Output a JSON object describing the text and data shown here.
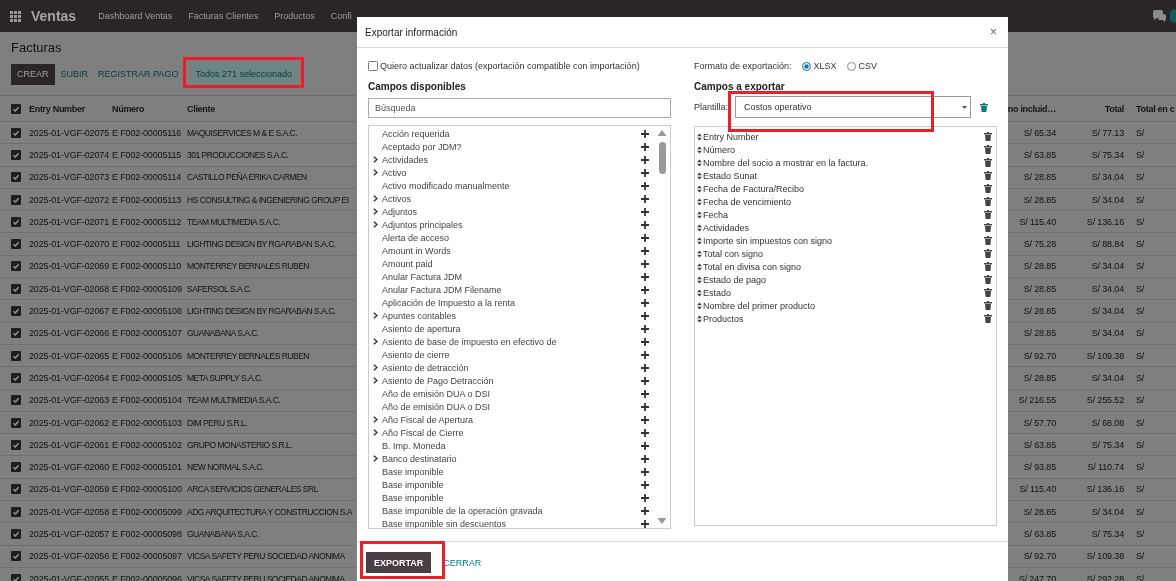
{
  "navbar": {
    "app": "Ventas",
    "menu": [
      "Dashboard Ventas",
      "Facturas Clientes",
      "Productos",
      "Confi"
    ]
  },
  "page": {
    "title": "Facturas",
    "buttons": [
      "CREAR",
      "SUBIR",
      "REGISTRAR PAGO"
    ],
    "selection_badge": "Todos 271 seleccionado"
  },
  "table": {
    "all_selected": true,
    "columns": [
      "Entry Number",
      "Número",
      "Cliente",
      "no incluid…",
      "Total",
      "Total en c"
    ],
    "rows": [
      {
        "selected": true,
        "cells": [
          "2025-01-VGF-02075",
          "E F002-00005116",
          "MAQUISERVICES M & E S.A.C.",
          "S/ 65.34",
          "S/ 77.13",
          "S/"
        ]
      },
      {
        "selected": true,
        "cells": [
          "2025-01-VGF-02074",
          "E F002-00005115",
          "301 PRODUCCIONES S.A.C.",
          "S/ 63.85",
          "S/ 75.34",
          "S/"
        ]
      },
      {
        "selected": true,
        "cells": [
          "2025-01-VGF-02073",
          "E F002-00005114",
          "CASTILLO PEÑA ERIKA CARMEN",
          "S/ 28.85",
          "S/ 34.04",
          "S/"
        ]
      },
      {
        "selected": true,
        "cells": [
          "2025-01-VGF-02072",
          "E F002-00005113",
          "HS CONSULTING & INGENIERING GROUP EI",
          "S/ 28.85",
          "S/ 34.04",
          "S/"
        ]
      },
      {
        "selected": true,
        "cells": [
          "2025-01-VGF-02071",
          "E F002-00005112",
          "TEAM MULTIMEDIA S.A.C.",
          "S/ 115.40",
          "S/ 136.16",
          "S/"
        ]
      },
      {
        "selected": true,
        "cells": [
          "2025-01-VGF-02070",
          "E F002-00005111",
          "LIGHTING DESIGN BY RGARABAN S.A.C.",
          "S/ 75.28",
          "S/ 88.84",
          "S/"
        ]
      },
      {
        "selected": true,
        "cells": [
          "2025-01-VGF-02069",
          "E F002-00005110",
          "MONTERREY BERNALES RUBEN",
          "S/ 28.85",
          "S/ 34.04",
          "S/"
        ]
      },
      {
        "selected": true,
        "cells": [
          "2025-01-VGF-02068",
          "E F002-00005109",
          "SAFERSOL S.A.C.",
          "S/ 28.85",
          "S/ 34.04",
          "S/"
        ]
      },
      {
        "selected": true,
        "cells": [
          "2025-01-VGF-02067",
          "E F002-00005108",
          "LIGHTING DESIGN BY RGARABAN S.A.C.",
          "S/ 28.85",
          "S/ 34.04",
          "S/"
        ]
      },
      {
        "selected": true,
        "cells": [
          "2025-01-VGF-02066",
          "E F002-00005107",
          "GUANABANA S.A.C.",
          "S/ 28.85",
          "S/ 34.04",
          "S/"
        ]
      },
      {
        "selected": true,
        "cells": [
          "2025-01-VGF-02065",
          "E F002-00005106",
          "MONTERREY BERNALES RUBEN",
          "S/ 92.70",
          "S/ 109.38",
          "S/"
        ]
      },
      {
        "selected": true,
        "cells": [
          "2025-01-VGF-02064",
          "E F002-00005105",
          "META SUPPLY S.A.C.",
          "S/ 28.85",
          "S/ 34.04",
          "S/"
        ]
      },
      {
        "selected": true,
        "cells": [
          "2025-01-VGF-02063",
          "E F002-00005104",
          "TEAM MULTIMEDIA S.A.C.",
          "S/ 216.55",
          "S/ 255.52",
          "S/"
        ]
      },
      {
        "selected": true,
        "cells": [
          "2025-01-VGF-02062",
          "E F002-00005103",
          "DIM PERU S.R.L.",
          "S/ 57.70",
          "S/ 68.08",
          "S/"
        ]
      },
      {
        "selected": true,
        "cells": [
          "2025-01-VGF-02061",
          "E F002-00005102",
          "GRUPO MONASTERIO S.R.L.",
          "S/ 63.85",
          "S/ 75.34",
          "S/"
        ]
      },
      {
        "selected": true,
        "cells": [
          "2025-01-VGF-02060",
          "E F002-00005101",
          "NEW NORMAL S.A.C.",
          "S/ 93.85",
          "S/ 110.74",
          "S/"
        ]
      },
      {
        "selected": true,
        "cells": [
          "2025-01-VGF-02059",
          "E F002-00005100",
          "ARCA SERVICIOS GENERALES SRL",
          "S/ 115.40",
          "S/ 136.16",
          "S/"
        ]
      },
      {
        "selected": true,
        "cells": [
          "2025-01-VGF-02058",
          "E F002-00005099",
          "ADG ARQUITECTURA Y CONSTRUCCION S.A",
          "S/ 28.85",
          "S/ 34.04",
          "S/"
        ]
      },
      {
        "selected": true,
        "cells": [
          "2025-01-VGF-02057",
          "E F002-00005098",
          "GUANABANA S.A.C.",
          "S/ 63.85",
          "S/ 75.34",
          "S/"
        ]
      },
      {
        "selected": true,
        "cells": [
          "2025-01-VGF-02056",
          "E F002-00005097",
          "VICSA SAFETY PERU SOCIEDAD ANONIMA",
          "S/ 92.70",
          "S/ 109.38",
          "S/"
        ]
      },
      {
        "selected": true,
        "cells": [
          "2025-01-VGF-02055",
          "E F002-00005096",
          "VICSA SAFETY PERU SOCIEDAD ANONIMA",
          "S/ 247.70",
          "S/ 292.28",
          "S/"
        ]
      }
    ]
  },
  "dialog": {
    "title": "Exportar información",
    "close": "×",
    "compat_option": {
      "label": "Quiero actualizar datos (exportación compatible con importación)",
      "checked": false
    },
    "available_title": "Campos disponibles",
    "search": {
      "placeholder": "Búsqueda"
    },
    "available_fields": [
      {
        "label": "Acción requerida",
        "expandable": false
      },
      {
        "label": "Aceptado por JDM?",
        "expandable": false
      },
      {
        "label": "Actividades",
        "expandable": true
      },
      {
        "label": "Activo",
        "expandable": true
      },
      {
        "label": "Activo modificado manualmente",
        "expandable": false
      },
      {
        "label": "Activos",
        "expandable": true
      },
      {
        "label": "Adjuntos",
        "expandable": true
      },
      {
        "label": "Adjuntos principales",
        "expandable": true
      },
      {
        "label": "Alerta de acceso",
        "expandable": false
      },
      {
        "label": "Amount in Words",
        "expandable": false
      },
      {
        "label": "Amount paid",
        "expandable": false
      },
      {
        "label": "Anular Factura JDM",
        "expandable": false
      },
      {
        "label": "Anular Factura JDM Filename",
        "expandable": false
      },
      {
        "label": "Aplicación de Impuesto a la renta",
        "expandable": false
      },
      {
        "label": "Apuntes contables",
        "expandable": true
      },
      {
        "label": "Asiento de apertura",
        "expandable": false
      },
      {
        "label": "Asiento de base de impuesto en efectivo de",
        "expandable": true
      },
      {
        "label": "Asiento de cierre",
        "expandable": false
      },
      {
        "label": "Asiento de detracción",
        "expandable": true
      },
      {
        "label": "Asiento de Pago Detracción",
        "expandable": true
      },
      {
        "label": "Año de emisión DUA o DSI",
        "expandable": false
      },
      {
        "label": "Año de emisión DUA o DSI",
        "expandable": false
      },
      {
        "label": "Año Fiscal de Apertura",
        "expandable": true
      },
      {
        "label": "Año Fiscal de Cierre",
        "expandable": true
      },
      {
        "label": "B. Imp. Moneda",
        "expandable": false
      },
      {
        "label": "Banco destinatario",
        "expandable": true
      },
      {
        "label": "Base imponible",
        "expandable": false
      },
      {
        "label": "Base imponible",
        "expandable": false
      },
      {
        "label": "Base imponible",
        "expandable": false
      },
      {
        "label": "Base imponible de la operación gravada",
        "expandable": false
      },
      {
        "label": "Base imponible sin descuentos",
        "expandable": false
      }
    ],
    "format_label": "Formato de exportación:",
    "formats": [
      {
        "label": "XLSX",
        "selected": true
      },
      {
        "label": "CSV",
        "selected": false
      }
    ],
    "export_title": "Campos a exportar",
    "template_label": "Plantilla:",
    "template_value": "Costos operativo",
    "export_fields": [
      "Entry Number",
      "Número",
      "Nombre del socio a mostrar en la factura.",
      "Estado Sunat",
      "Fecha de Factura/Recibo",
      "Fecha de vencimiento",
      "Fecha",
      "Actividades",
      "Importe sin impuestos con signo",
      "Total con signo",
      "Total en divisa con signo",
      "Estado de pago",
      "Estado",
      "Nombre del primer producto",
      "Productos"
    ],
    "primary_button": "EXPORTAR",
    "secondary_button": "CERRAR"
  }
}
